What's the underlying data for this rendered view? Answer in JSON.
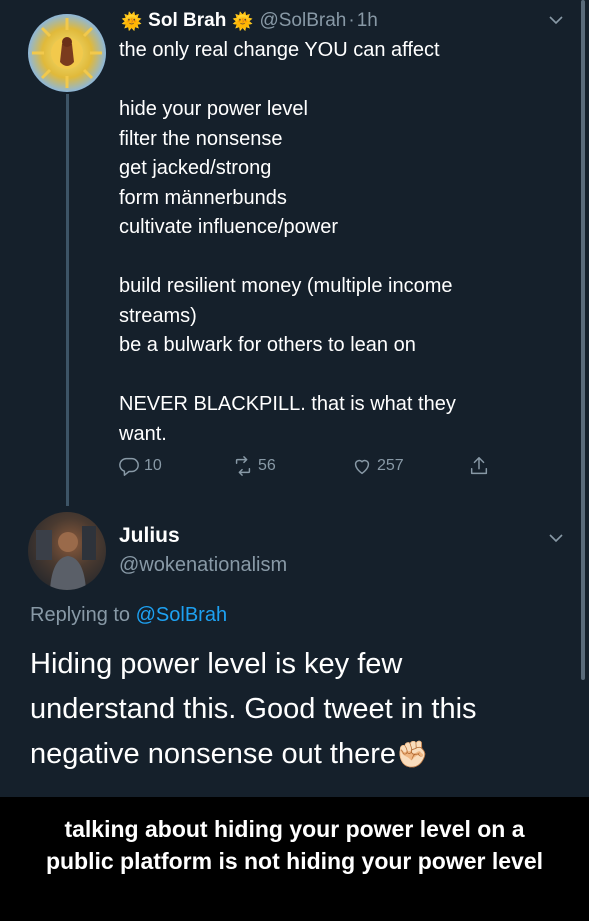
{
  "tweet": {
    "display_name": "Sol Brah",
    "name_emoji": "🌞",
    "handle": "@SolBrah",
    "separator": "·",
    "time": "1h",
    "lines": [
      "the only real change YOU can affect",
      "",
      "hide your power level",
      "filter the nonsense",
      "get jacked/strong",
      "form männerbunds",
      "cultivate influence/power",
      "",
      "build resilient money (multiple income",
      "streams)",
      "be a bulwark for others to lean on",
      "",
      "NEVER BLACKPILL.  that is what they",
      "want."
    ],
    "reply_count": "10",
    "retweet_count": "56",
    "like_count": "257"
  },
  "reply": {
    "display_name": "Julius",
    "handle": "@wokenationalism",
    "replying_prefix": "Replying to ",
    "replying_to": "@SolBrah",
    "lines": [
      "Hiding power level is key few",
      "understand this. Good tweet in this",
      "negative nonsense out there"
    ],
    "emoji": "✊🏻"
  },
  "caption": {
    "line1": "talking about hiding your power level on a",
    "line2": "public platform is not hiding your power level"
  },
  "icons": {
    "menu": "chevron-down-icon",
    "reply": "reply-icon",
    "retweet": "retweet-icon",
    "like": "heart-icon",
    "share": "share-icon"
  },
  "colors": {
    "background": "#15202b",
    "secondary_text": "#8899a6",
    "link": "#1da1f2",
    "caption_background": "#000000"
  }
}
